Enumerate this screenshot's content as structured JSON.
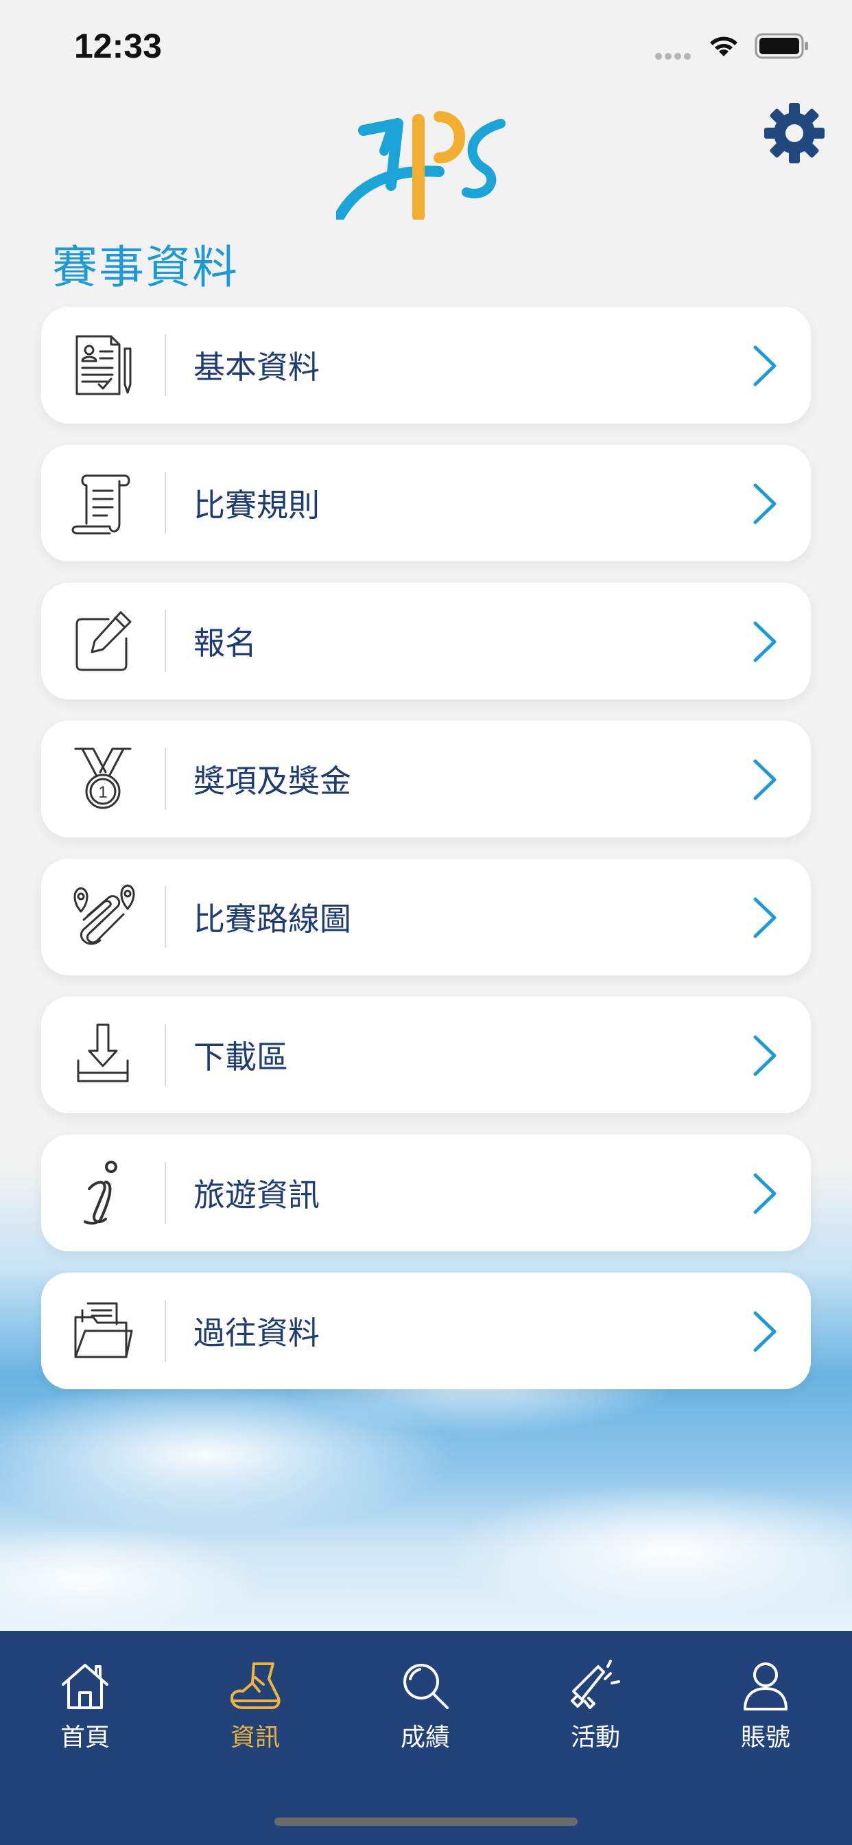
{
  "status_bar": {
    "time": "12:33"
  },
  "header": {
    "section_title": "賽事資料"
  },
  "menu": {
    "items": [
      {
        "label": "基本資料",
        "icon": "document-form-icon"
      },
      {
        "label": "比賽規則",
        "icon": "scroll-icon"
      },
      {
        "label": "報名",
        "icon": "edit-icon"
      },
      {
        "label": "獎項及獎金",
        "icon": "medal-icon"
      },
      {
        "label": "比賽路線圖",
        "icon": "route-map-icon"
      },
      {
        "label": "下載區",
        "icon": "download-icon"
      },
      {
        "label": "旅遊資訊",
        "icon": "info-icon"
      },
      {
        "label": "過往資料",
        "icon": "folder-icon"
      }
    ]
  },
  "tab_bar": {
    "tabs": [
      {
        "label": "首頁",
        "icon": "home-icon",
        "active": false
      },
      {
        "label": "資訊",
        "icon": "running-shoe-icon",
        "active": true
      },
      {
        "label": "成績",
        "icon": "search-icon",
        "active": false
      },
      {
        "label": "活動",
        "icon": "megaphone-icon",
        "active": false
      },
      {
        "label": "賬號",
        "icon": "user-icon",
        "active": false
      }
    ]
  },
  "colors": {
    "accent": "#1d9ad6",
    "label_text": "#1e3b74",
    "tab_bar_bg": "#21437a",
    "tab_active": "#f0b43c",
    "gear": "#21497f"
  }
}
